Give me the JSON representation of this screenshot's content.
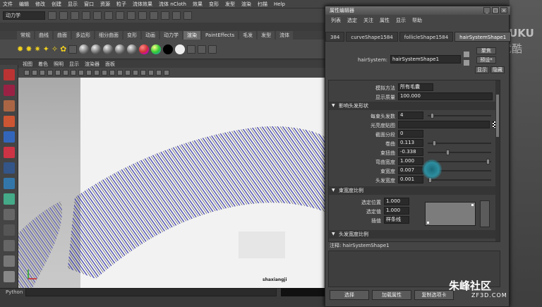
{
  "menubar": [
    "文件",
    "编辑",
    "修改",
    "创建",
    "显示",
    "窗口",
    "资源",
    "粒子",
    "流体效果",
    "流体 nCloth",
    "效果",
    "变形",
    "发型",
    "渲染",
    "扫描",
    "Help"
  ],
  "toolbar": {
    "mode_combo": "动力学"
  },
  "shelf_tabs": [
    "常规",
    "曲线",
    "曲面",
    "多边形",
    "细分曲面",
    "变形",
    "动画",
    "动力学",
    "渲染",
    "PaintEffects",
    "毛发",
    "发型",
    "流体"
  ],
  "shelf_active": "渲染",
  "viewport_menu": [
    "视图",
    "着色",
    "照明",
    "显示",
    "渲染器",
    "面板"
  ],
  "python_label": "Python",
  "credit": "shaxiangji",
  "attribute_editor": {
    "title": "属性编辑器",
    "menu": [
      "列表",
      "选定",
      "关注",
      "属性",
      "显示",
      "帮助"
    ],
    "tabs": [
      "384",
      "curveShape1584",
      "follicleShape1584",
      "hairSystemShape1"
    ],
    "active_tab": "hairSystemShape1",
    "node_label": "hairSystem:",
    "node_value": "hairSystemShape1",
    "buttons": {
      "focus": "聚焦",
      "presets": "预设*",
      "show": "显示",
      "hide": "隐藏"
    },
    "rows_top": [
      {
        "label": "模拟方法",
        "value": "所有毛囊"
      },
      {
        "label": "显示质量",
        "value": "100.000"
      }
    ],
    "frame_hair_shape": "影响头发形状",
    "hair_shape_rows": [
      {
        "label": "每束头发数",
        "value": "4"
      },
      {
        "label": "光亮度贴图",
        "value": ""
      },
      {
        "label": "截面分段",
        "value": "0"
      },
      {
        "label": "卷曲",
        "value": "0.113"
      },
      {
        "label": "束扭曲",
        "value": "-0.338"
      },
      {
        "label": "弯曲宽度",
        "value": "1.000"
      },
      {
        "label": "束宽度",
        "value": "0.007"
      },
      {
        "label": "头发宽度",
        "value": "0.001"
      }
    ],
    "frame_width_scale": "束宽度比例",
    "width_scale_rows": [
      {
        "label": "选定位置",
        "value": "1.000"
      },
      {
        "label": "选定值",
        "value": "1.000"
      },
      {
        "label": "插值",
        "value": "样条线"
      }
    ],
    "frame_next": "头发宽度比例",
    "notes_label": "注释: hairSystemShape1",
    "bottom_buttons": [
      "选择",
      "加载属性",
      "复制选项卡"
    ]
  },
  "watermarks": {
    "youku": "YOUKU",
    "youku_cn": "优酷",
    "site": "朱峰社区",
    "site_url": "ZF3D.COM"
  }
}
